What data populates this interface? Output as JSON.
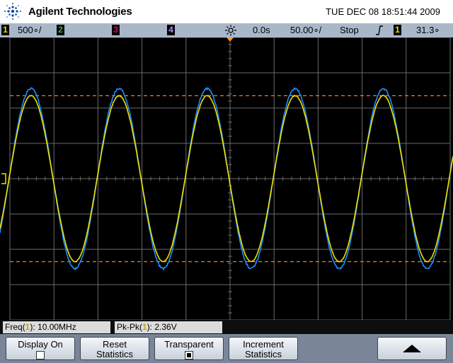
{
  "header": {
    "brand": "Agilent Technologies",
    "datetime": "TUE DEC 08 18:51:44 2009"
  },
  "status_bar": {
    "ch1": {
      "label": "1",
      "scale": "500∘/",
      "color": "#f0e000"
    },
    "ch2": {
      "label": "2",
      "color": "#2db84a"
    },
    "ch3": {
      "label": "3",
      "color": "#e6007a"
    },
    "ch4": {
      "label": "4",
      "color": "#b48cff"
    },
    "trigger_pos_icon": "sun-trigger-icon",
    "delay": "0.0s",
    "timebase": "50.00∘/",
    "run_state": "Stop",
    "trigger_edge_icon": "rising-edge-icon",
    "trigger_source": "1",
    "trigger_level": "31.3∘"
  },
  "measurements": {
    "freq_label": "Freq(",
    "freq_ch": "1",
    "freq_value": "): 10.00MHz",
    "pkpk_label": "Pk-Pk(",
    "pkpk_ch": "1",
    "pkpk_value": "): 2.36V"
  },
  "softkeys": {
    "display_on": {
      "line1": "Display On",
      "checked": false
    },
    "reset_stats": {
      "line1": "Reset",
      "line2": "Statistics"
    },
    "transparent": {
      "line1": "Transparent",
      "checked": true
    },
    "increment_stats": {
      "line1": "Increment",
      "line2": "Statistics"
    },
    "up_arrow_icon": "up-arrow-icon"
  },
  "waveforms": {
    "ch1_color": "#f0e000",
    "ref_color": "#1e90ff",
    "cursor_color": "#ff7a1a",
    "periods_on_screen": 5
  }
}
